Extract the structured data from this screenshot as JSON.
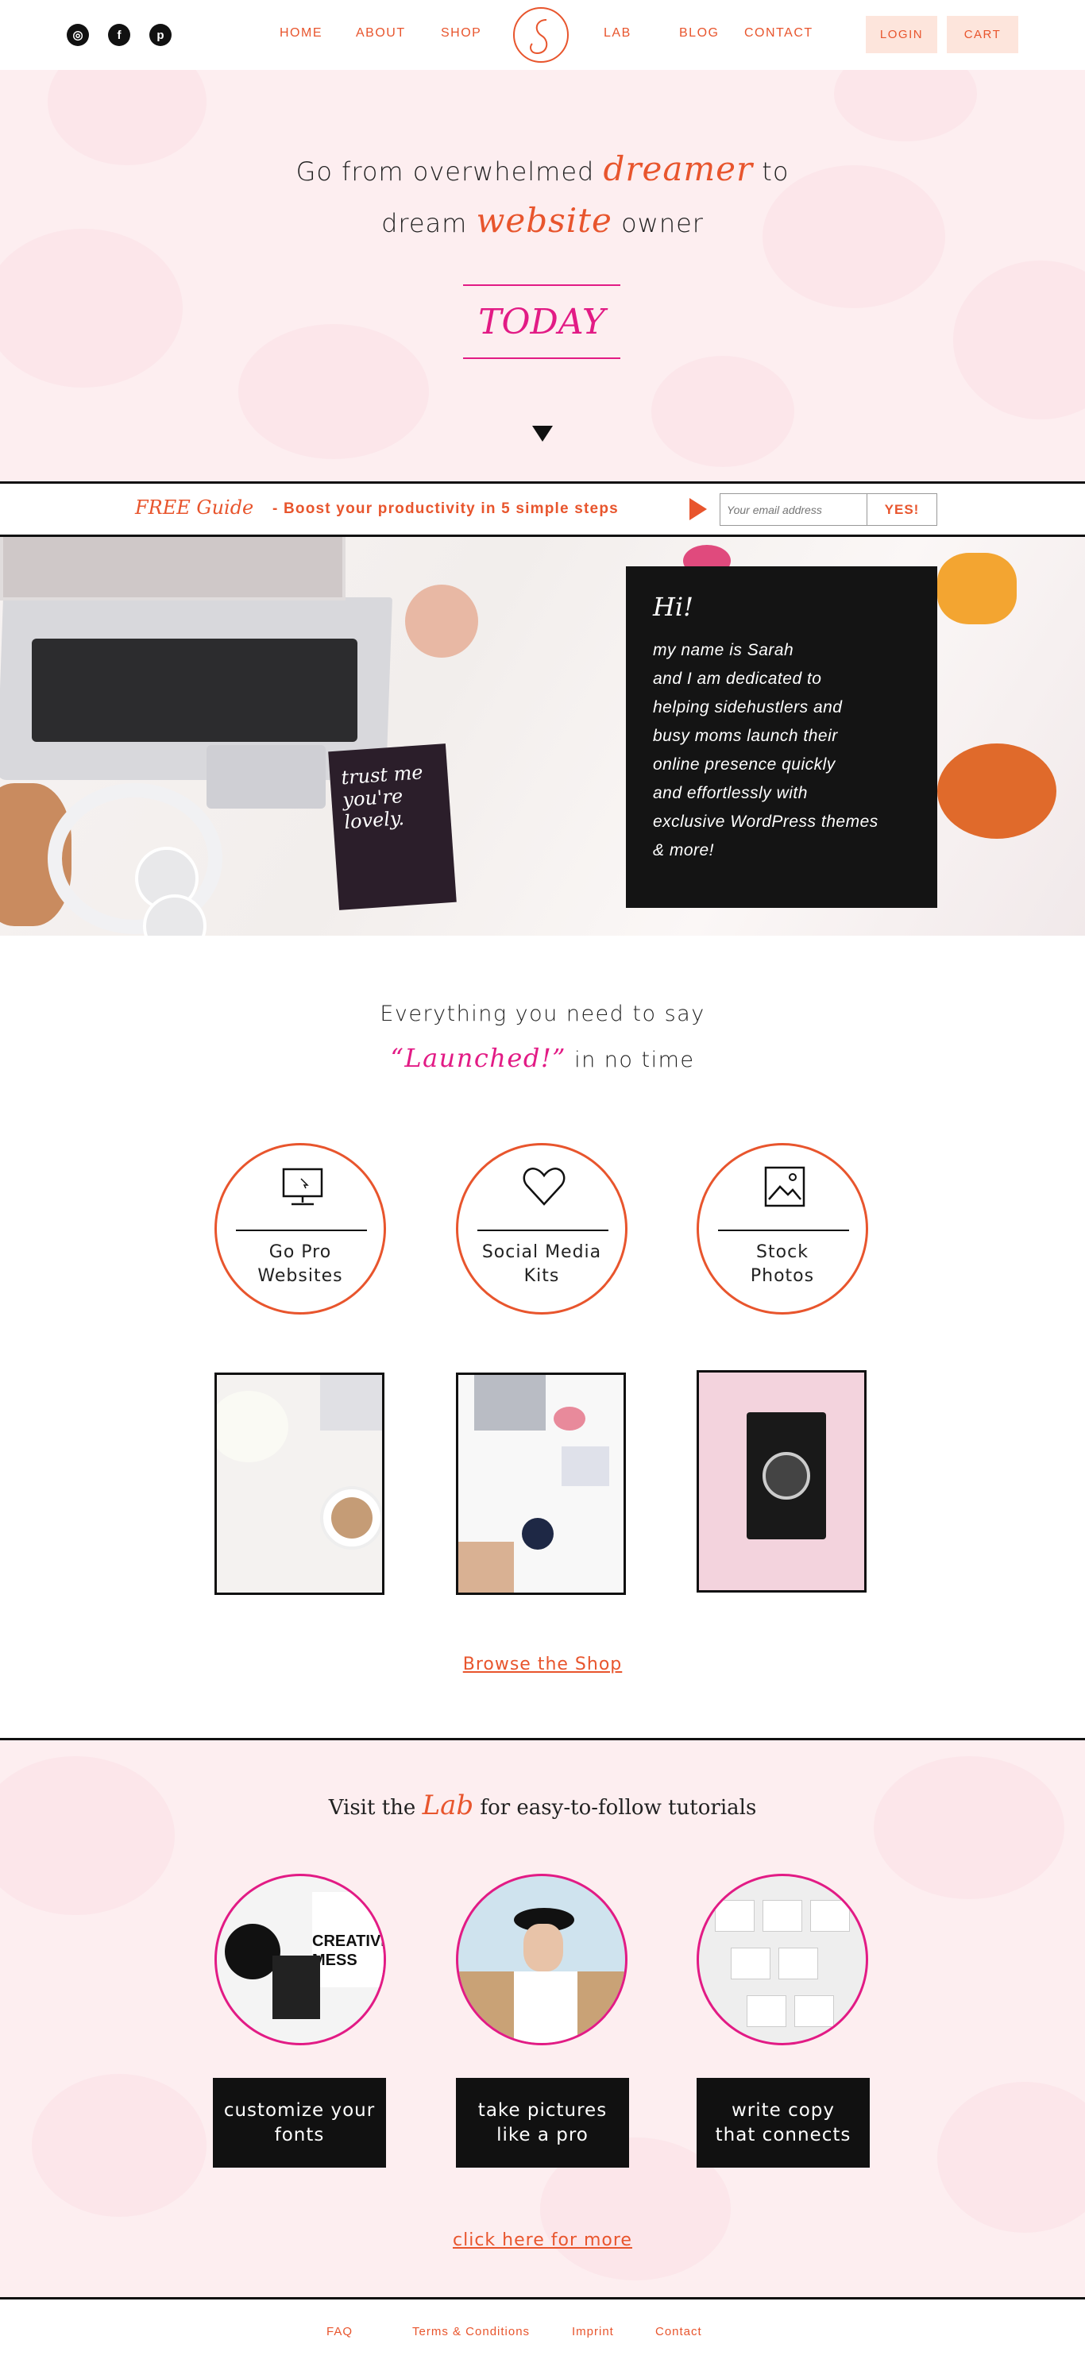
{
  "header": {
    "social": [
      {
        "icon": "instagram-icon",
        "glyph": "◎"
      },
      {
        "icon": "facebook-icon",
        "glyph": "f"
      },
      {
        "icon": "pinterest-icon",
        "glyph": "p"
      }
    ],
    "nav": {
      "home": "HOME",
      "about": "ABOUT",
      "shop": "SHOP",
      "lab": "LAB",
      "blog": "BLOG",
      "contact": "CONTACT"
    },
    "login": "LOGIN",
    "cart": "CART"
  },
  "hero": {
    "line1_pre": "Go from overwhelmed ",
    "line1_accent": "dreamer",
    "line1_post": " to",
    "line2_pre": "dream ",
    "line2_accent": "website",
    "line2_post": " owner",
    "cta": "TODAY"
  },
  "optin": {
    "free": "FREE Guide",
    "text": "- Boost your productivity in 5 simple steps",
    "placeholder": "Your email address",
    "button": "YES!"
  },
  "about": {
    "greeting": "Hi!",
    "lines": [
      "my name is Sarah",
      "and I am dedicated to",
      "helping sidehustlers and",
      "busy moms launch their",
      "online presence quickly",
      "and effortlessly with",
      "exclusive WordPress themes",
      "& more!"
    ],
    "card_text": "trust me you're lovely."
  },
  "products": {
    "heading1": "Everything you need to say",
    "heading2_accent": "“Launched!”",
    "heading2_post": " in no time",
    "items": [
      {
        "line1": "Go Pro",
        "line2": "Websites",
        "icon": "monitor-icon"
      },
      {
        "line1": "Social Media",
        "line2": "Kits",
        "icon": "heart-icon"
      },
      {
        "line1": "Stock",
        "line2": "Photos",
        "icon": "image-icon"
      }
    ],
    "browse": "Browse the Shop"
  },
  "lab": {
    "pre": "Visit the ",
    "accent": "Lab",
    "post": " for easy-to-follow tutorials",
    "items": [
      {
        "line1": "customize your",
        "line2": "fonts",
        "badge1": "CREATIVE",
        "badge2": "MESS"
      },
      {
        "line1": "take pictures",
        "line2": "like a pro"
      },
      {
        "line1": "write copy",
        "line2": "that connects"
      }
    ],
    "more": "click here for more"
  },
  "footer": {
    "faq": "FAQ",
    "terms": "Terms & Conditions",
    "imprint": "Imprint",
    "contact": "Contact"
  },
  "colors": {
    "accent": "#e8552d",
    "magenta": "#e21b85",
    "pink_bg": "#fdeef0",
    "dark": "#111111"
  }
}
